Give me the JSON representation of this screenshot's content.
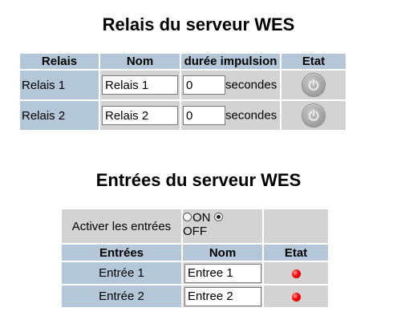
{
  "relays_section": {
    "title": "Relais du serveur WES",
    "headers": {
      "relay": "Relais",
      "name": "Nom",
      "pulse": "durée impulsion",
      "state": "Etat"
    },
    "rows": [
      {
        "label": "Relais 1",
        "name": "Relais 1",
        "pulse": "0",
        "unit": "secondes",
        "state_icon": "power-icon"
      },
      {
        "label": "Relais 2",
        "name": "Relais 2",
        "pulse": "0",
        "unit": "secondes",
        "state_icon": "power-icon"
      }
    ]
  },
  "inputs_section": {
    "title": "Entrées du serveur WES",
    "activate_label": "Activer les entrées",
    "radio_on": "ON",
    "radio_off": "OFF",
    "selected": "OFF",
    "headers": {
      "input": "Entrées",
      "name": "Nom",
      "state": "Etat"
    },
    "rows": [
      {
        "label": "Entrée 1",
        "name": "Entree 1",
        "state_color": "#ff0000"
      },
      {
        "label": "Entrée 2",
        "name": "Entree 2",
        "state_color": "#ff0000"
      }
    ]
  },
  "colors": {
    "header_bg": "#b3c7d9",
    "cell_bg": "#d3d3d3",
    "led_red": "#ff0000"
  }
}
